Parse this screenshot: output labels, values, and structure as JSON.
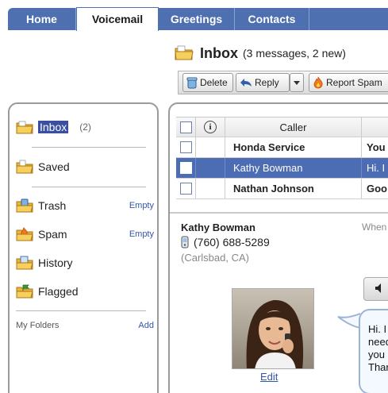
{
  "tabs": [
    {
      "label": "Home"
    },
    {
      "label": "Voicemail"
    },
    {
      "label": "Greetings"
    },
    {
      "label": "Contacts"
    }
  ],
  "active_tab": "Voicemail",
  "header": {
    "title": "Inbox",
    "count_text": "(3 messages, 2 new)",
    "icon": "inbox-folder-icon"
  },
  "toolbar": {
    "delete_label": "Delete",
    "reply_label": "Reply",
    "spam_label": "Report Spam"
  },
  "sidebar": {
    "items": [
      {
        "label": "Inbox",
        "count": "(2)",
        "action": "",
        "icon": "inbox-folder-icon"
      },
      {
        "label": "Saved",
        "count": "",
        "action": "",
        "icon": "saved-folder-icon"
      },
      {
        "label": "Trash",
        "count": "",
        "action": "Empty",
        "icon": "trash-folder-icon"
      },
      {
        "label": "Spam",
        "count": "",
        "action": "Empty",
        "icon": "spam-folder-icon"
      },
      {
        "label": "History",
        "count": "",
        "action": "",
        "icon": "history-folder-icon"
      },
      {
        "label": "Flagged",
        "count": "",
        "action": "",
        "icon": "flagged-folder-icon"
      }
    ],
    "my_folders_label": "My Folders",
    "add_label": "Add"
  },
  "messages": {
    "columns": {
      "caller": "Caller"
    },
    "rows": [
      {
        "caller": "Honda Service",
        "preview": "You",
        "unread": true,
        "selected": false
      },
      {
        "caller": "Kathy Bowman",
        "preview": "Hi. I",
        "unread": false,
        "selected": true
      },
      {
        "caller": "Nathan Johnson",
        "preview": "Goo",
        "unread": true,
        "selected": false
      }
    ]
  },
  "detail": {
    "name": "Kathy Bowman",
    "when_label": "When",
    "phone": "(760) 688-5289",
    "location": "(Carlsbad, CA)",
    "edit_label": "Edit",
    "transcript_lines": [
      "Hi. I",
      "need",
      "you",
      "Thar"
    ]
  },
  "colors": {
    "tab_bar": "#4e6fb0",
    "selected_row": "#4c6cb4",
    "inbox_highlight": "#3a4fa0",
    "link": "#3355aa"
  }
}
